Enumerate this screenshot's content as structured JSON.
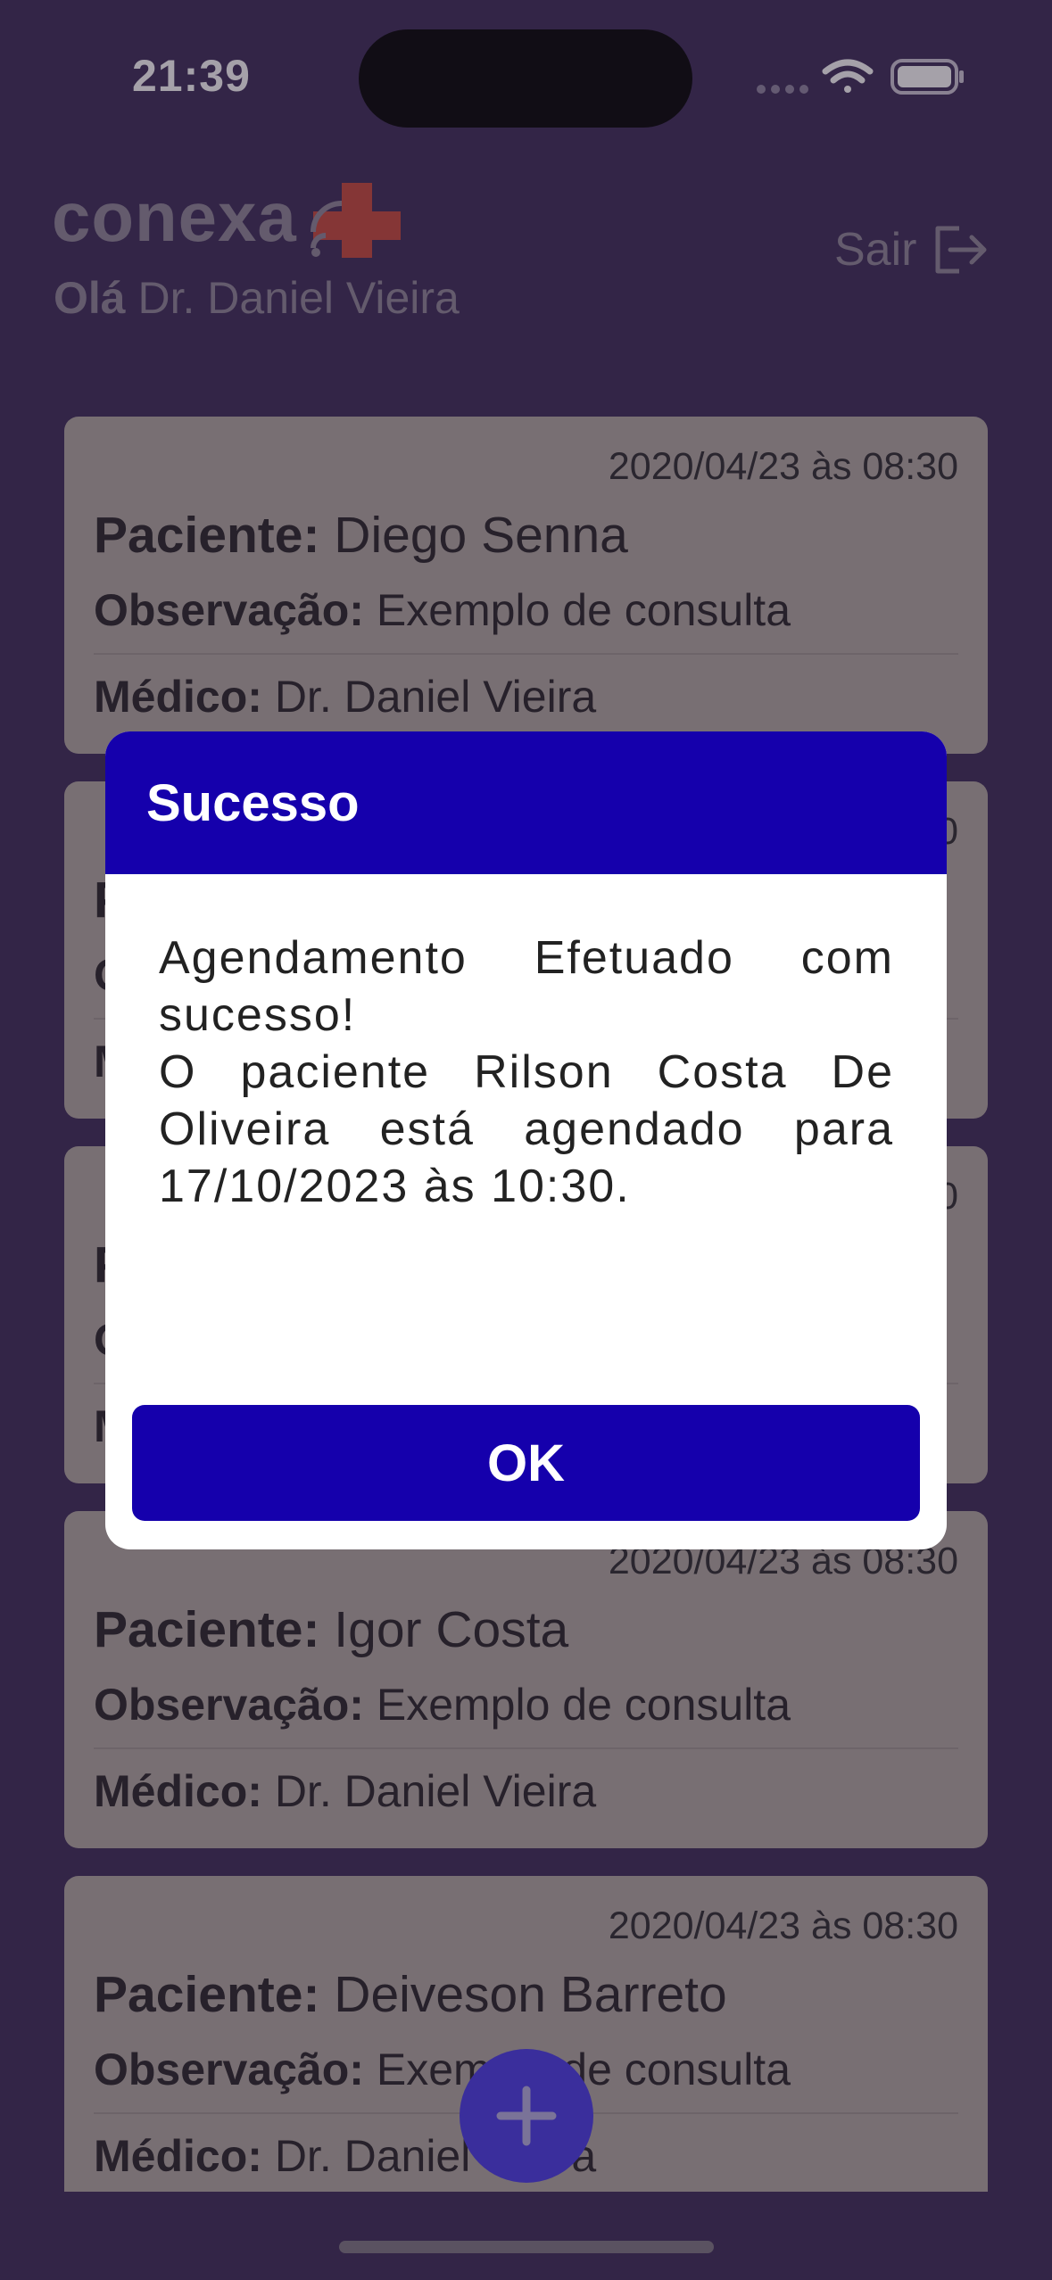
{
  "status_bar": {
    "time": "21:39"
  },
  "header": {
    "logo_text": "conexa",
    "greeting_prefix": "Olá",
    "greeting_name": "Dr. Daniel Vieira",
    "logout_label": "Sair"
  },
  "labels": {
    "patient": "Paciente:",
    "observation": "Observação:",
    "doctor": "Médico:"
  },
  "appointments": [
    {
      "date": "2020/04/23 às 08:30",
      "patient": "Diego Senna",
      "observation": "Exemplo de consulta",
      "doctor": "Dr. Daniel Vieira"
    },
    {
      "date": "2020/04/23 às 08:30",
      "patient": "",
      "observation": "",
      "doctor": ""
    },
    {
      "date": "2020/04/23 às 08:30",
      "patient": "",
      "observation": "",
      "doctor": ""
    },
    {
      "date": "2020/04/23 às 08:30",
      "patient": "Igor Costa",
      "observation": "Exemplo de consulta",
      "doctor": "Dr. Daniel Vieira"
    },
    {
      "date": "2020/04/23 às 08:30",
      "patient": "Deiveson Barreto",
      "observation": "Exemplo de consulta",
      "doctor": "Dr. Daniel Vieira"
    }
  ],
  "dialog": {
    "title": "Sucesso",
    "message_line1": "Agendamento Efetuado com sucesso!",
    "message_line2": "O paciente Rilson Costa De Oliveira está agendado para 17/10/2023 às 10:30.",
    "ok_label": "OK"
  },
  "colors": {
    "background": "#3b2a57",
    "dialog_accent": "#1500ac",
    "card": "#b2a9a2",
    "fab": "#3a2e9c",
    "logo_cross": "#d2412f"
  },
  "icons": {
    "logout": "logout-icon",
    "fab": "plus-icon",
    "wifi": "wifi-icon",
    "battery": "battery-icon",
    "signal": "signal-icon"
  }
}
